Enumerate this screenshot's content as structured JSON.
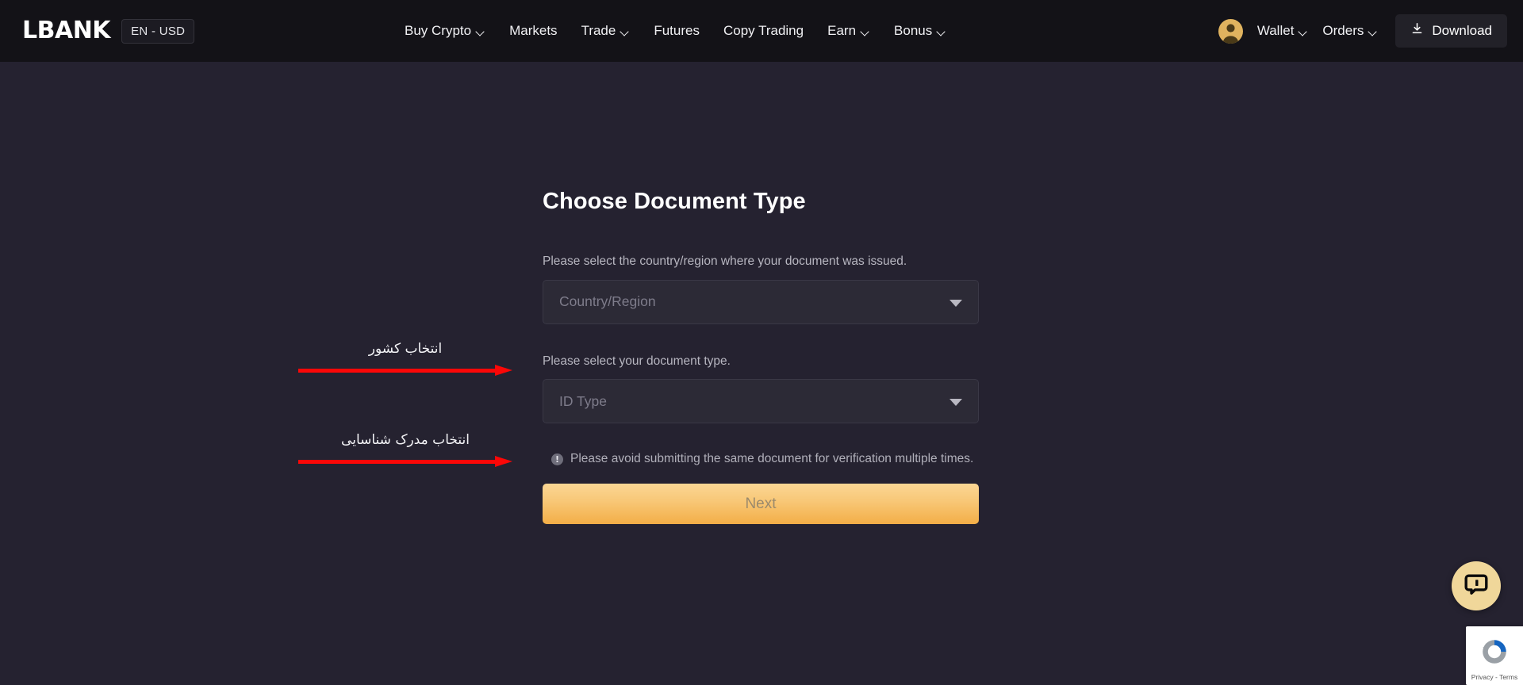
{
  "header": {
    "logo_text": "LBANK",
    "locale_pill": "EN - USD",
    "nav_items": [
      {
        "label": "Buy Crypto",
        "has_caret": true
      },
      {
        "label": "Markets",
        "has_caret": false
      },
      {
        "label": "Trade",
        "has_caret": true
      },
      {
        "label": "Futures",
        "has_caret": false
      },
      {
        "label": "Copy Trading",
        "has_caret": false
      },
      {
        "label": "Earn",
        "has_caret": true
      },
      {
        "label": "Bonus",
        "has_caret": true
      }
    ],
    "avatar_icon": "user-avatar-icon",
    "wallet_label": "Wallet",
    "orders_label": "Orders",
    "download_label": "Download",
    "download_icon": "download-icon"
  },
  "main": {
    "title": "Choose Document Type",
    "country_field": {
      "label": "Please select the country/region where your document was issued.",
      "placeholder": "Country/Region",
      "value": "",
      "caret_icon": "chevron-down-icon"
    },
    "id_type_field": {
      "label": "Please select your document type.",
      "placeholder": "ID Type",
      "value": "",
      "caret_icon": "chevron-down-icon"
    },
    "notice": {
      "icon": "info-circle-icon",
      "icon_glyph": "!",
      "text": "Please avoid submitting the same document for verification multiple times."
    },
    "next_button": {
      "label": "Next",
      "disabled": true
    }
  },
  "annotations": [
    {
      "text": "انتخاب کشور",
      "arrow_color": "#fb0707",
      "target": "country-region-select"
    },
    {
      "text": "انتخاب مدرک شناسایی",
      "arrow_color": "#fb0707",
      "target": "id-type-select"
    }
  ],
  "widgets": {
    "chat": {
      "icon": "chat-bubble-icon",
      "bg_color": "#f0d79a"
    },
    "recaptcha": {
      "icon": "recaptcha-logo-icon",
      "text": "Privacy - Terms"
    }
  },
  "colors": {
    "page_bg": "#252230",
    "header_bg": "#131217",
    "field_bg": "#2c2a36",
    "accent": "#f3ae47",
    "annotation_red": "#fb0707"
  }
}
